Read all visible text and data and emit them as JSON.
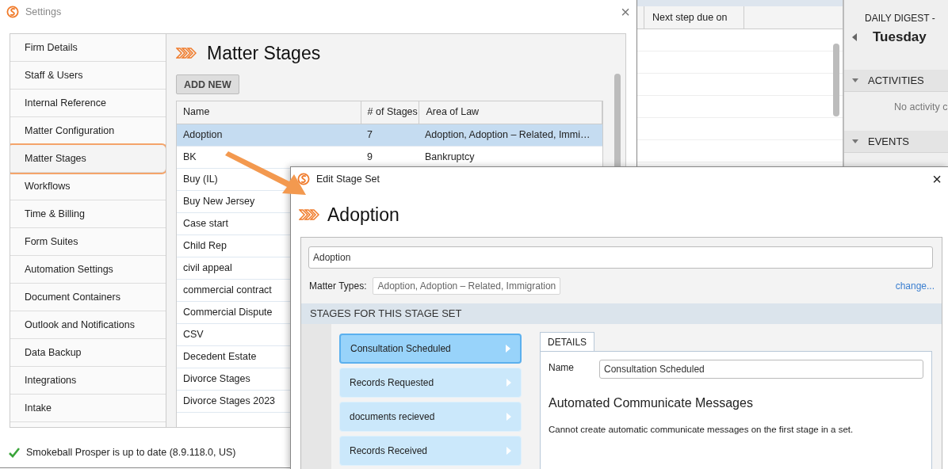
{
  "background_app": {
    "table": {
      "columns": [
        "Next step due on"
      ]
    },
    "daily_digest": {
      "title": "DAILY DIGEST -",
      "day": "Tuesday",
      "sections": [
        {
          "title": "ACTIVITIES",
          "expanded": true,
          "empty_text": "No activity c"
        },
        {
          "title": "EVENTS",
          "expanded": true
        }
      ]
    }
  },
  "settings_window": {
    "title": "Settings",
    "close": "×",
    "sidebar": {
      "items": [
        {
          "label": "Firm Details",
          "highlighted": false
        },
        {
          "label": "Staff & Users",
          "highlighted": false
        },
        {
          "label": "Internal Reference",
          "highlighted": false
        },
        {
          "label": "Matter Configuration",
          "highlighted": false
        },
        {
          "label": "Matter Stages",
          "highlighted": true
        },
        {
          "label": "Workflows",
          "highlighted": false
        },
        {
          "label": "Time & Billing",
          "highlighted": false
        },
        {
          "label": "Form Suites",
          "highlighted": false
        },
        {
          "label": "Automation Settings",
          "highlighted": false
        },
        {
          "label": "Document Containers",
          "highlighted": false
        },
        {
          "label": "Outlook and Notifications",
          "highlighted": false
        },
        {
          "label": "Data Backup",
          "highlighted": false
        },
        {
          "label": "Integrations",
          "highlighted": false
        },
        {
          "label": "Intake",
          "highlighted": false
        }
      ]
    },
    "heading": "Matter Stages",
    "add_button": "ADD NEW",
    "table": {
      "columns": [
        "Name",
        "# of Stages",
        "Area of Law"
      ],
      "rows": [
        {
          "cells": [
            "Adoption",
            "7",
            "Adoption, Adoption – Related, Immi…"
          ],
          "selected": true
        },
        {
          "cells": [
            "BK",
            "9",
            "Bankruptcy"
          ],
          "selected": false
        },
        {
          "cells": [
            "Buy (IL)"
          ],
          "selected": false
        },
        {
          "cells": [
            "Buy New Jersey"
          ],
          "selected": false
        },
        {
          "cells": [
            "Case start"
          ],
          "selected": false
        },
        {
          "cells": [
            "Child Rep"
          ],
          "selected": false
        },
        {
          "cells": [
            "civil appeal"
          ],
          "selected": false
        },
        {
          "cells": [
            "commercial contract"
          ],
          "selected": false
        },
        {
          "cells": [
            "Commercial Dispute"
          ],
          "selected": false
        },
        {
          "cells": [
            "CSV"
          ],
          "selected": false
        },
        {
          "cells": [
            "Decedent Estate"
          ],
          "selected": false
        },
        {
          "cells": [
            "Divorce Stages"
          ],
          "selected": false
        },
        {
          "cells": [
            "Divorce Stages 2023"
          ],
          "selected": false
        }
      ]
    },
    "status_bar": "Smokeball Prosper is up to date (8.9.118.0, US)"
  },
  "edit_dialog": {
    "title": "Edit Stage Set",
    "close": "×",
    "heading": "Adoption",
    "name_value": "Adoption",
    "matter_types_label": "Matter Types:",
    "matter_types_value": "Adoption, Adoption – Related, Immigration",
    "change_link": "change...",
    "section_title": "STAGES FOR THIS STAGE SET",
    "stages": [
      {
        "label": "Consultation Scheduled",
        "selected": true
      },
      {
        "label": "Records Requested",
        "selected": false
      },
      {
        "label": "documents recieved",
        "selected": false
      },
      {
        "label": "Records Received",
        "selected": false
      }
    ],
    "tabs": [
      {
        "label": "DETAILS",
        "selected": true
      }
    ],
    "details": {
      "name_label": "Name",
      "name_value": "Consultation Scheduled",
      "messages_title": "Automated Communicate Messages",
      "messages_note": "Cannot create automatic communicate messages on the first stage in a set."
    }
  }
}
